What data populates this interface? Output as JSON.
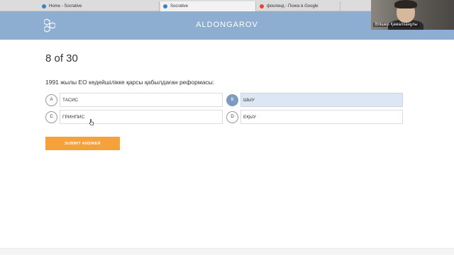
{
  "browser": {
    "tabs": [
      {
        "title": "Home - Socrative",
        "icon": "socrative-icon",
        "color": "#3b82c4"
      },
      {
        "title": "Socrative",
        "icon": "socrative-icon",
        "color": "#3b82c4"
      },
      {
        "title": "фокленд - Поиск в Google",
        "icon": "google-icon",
        "color": "#ea4335"
      }
    ]
  },
  "header": {
    "room_name": "ALDONGAROV",
    "background": "#8eaed1"
  },
  "video": {
    "participant_name": "Әлішер Қамалханұлы"
  },
  "quiz": {
    "progress": "8 of 30",
    "question": "1991 жылы ЕО кедейшілікке қарсы қабылдаған реформасы:",
    "choices": [
      {
        "letter": "A",
        "text": "ТАСИС",
        "selected": false
      },
      {
        "letter": "B",
        "text": "ШЫУ",
        "selected": true
      },
      {
        "letter": "C",
        "text": "ГРИНПИС",
        "selected": false
      },
      {
        "letter": "D",
        "text": "ЕҚЫУ",
        "selected": false
      }
    ],
    "submit_label": "SUBMIT ANSWER",
    "accent": "#f5a23a",
    "selected_color": "#7d9bc2"
  }
}
